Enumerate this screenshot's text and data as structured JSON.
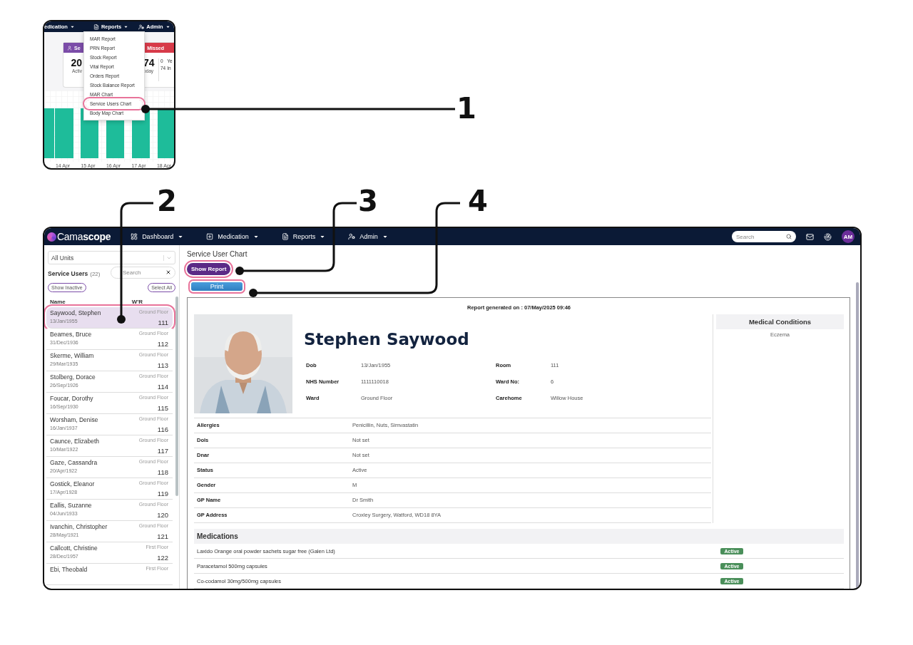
{
  "inset": {
    "nav": [
      {
        "label": "edication"
      },
      {
        "label": "Reports"
      },
      {
        "label": "Admin"
      }
    ],
    "cards": {
      "tabs": [
        {
          "label": "Se"
        },
        {
          "label": "Missed"
        }
      ],
      "stats": [
        {
          "value": "20",
          "caption": "Activ"
        },
        {
          "value": "74",
          "caption": "oday"
        }
      ],
      "extra": [
        "0",
        "Ye",
        "74",
        "In"
      ]
    },
    "chart_x_labels": [
      "14 Apr",
      "15 Apr",
      "16 Apr",
      "17 Apr",
      "18 Apr"
    ],
    "menu": [
      {
        "label": "MAR Report",
        "highlighted": false
      },
      {
        "label": "PRN Report",
        "highlighted": false
      },
      {
        "label": "Stock Report",
        "highlighted": false
      },
      {
        "label": "Vital Report",
        "highlighted": false
      },
      {
        "label": "Orders Report",
        "highlighted": false
      },
      {
        "label": "Stock Balance Report",
        "highlighted": false
      },
      {
        "label": "MAR Chart",
        "highlighted": false
      },
      {
        "label": "Service Users Chart",
        "highlighted": true
      },
      {
        "label": "Body Map Chart",
        "highlighted": false
      }
    ]
  },
  "app": {
    "logo": "Cama**scope**",
    "nav": [
      {
        "label": "Dashboard"
      },
      {
        "label": "Medication"
      },
      {
        "label": "Reports"
      },
      {
        "label": "Admin"
      }
    ],
    "search": {
      "placeholder": "Search"
    },
    "avatar": "AM"
  },
  "sidebar": {
    "unit_select": "All Units",
    "title": "Service Users",
    "count": "(22)",
    "search": {
      "placeholder": "Search"
    },
    "show_inactive": "Show Inactive",
    "select_all": "Select All",
    "columns": [
      "Name",
      "W'R"
    ],
    "rows": [
      {
        "name": "Saywood, Stephen",
        "dob": "13/Jan/1955",
        "ward": "Ground Floor",
        "room": "111",
        "selected": true,
        "highlighted": true
      },
      {
        "name": "Beames, Bruce",
        "dob": "31/Dec/1936",
        "ward": "Ground Floor",
        "room": "112",
        "selected": false,
        "highlighted": false
      },
      {
        "name": "Skerme, William",
        "dob": "29/Mar/1935",
        "ward": "Ground Floor",
        "room": "113",
        "selected": false,
        "highlighted": false
      },
      {
        "name": "Stolberg, Dorace",
        "dob": "26/Sep/1926",
        "ward": "Ground Floor",
        "room": "114",
        "selected": false,
        "highlighted": false
      },
      {
        "name": "Foucar, Dorothy",
        "dob": "16/Sep/1930",
        "ward": "Ground Floor",
        "room": "115",
        "selected": false,
        "highlighted": false
      },
      {
        "name": "Worsham, Denise",
        "dob": "16/Jan/1937",
        "ward": "Ground Floor",
        "room": "116",
        "selected": false,
        "highlighted": false
      },
      {
        "name": "Caunce, Elizabeth",
        "dob": "10/Mar/1922",
        "ward": "Ground Floor",
        "room": "117",
        "selected": false,
        "highlighted": false
      },
      {
        "name": "Gaze, Cassandra",
        "dob": "20/Apr/1922",
        "ward": "Ground Floor",
        "room": "118",
        "selected": false,
        "highlighted": false
      },
      {
        "name": "Gostick, Eleanor",
        "dob": "17/Apr/1928",
        "ward": "Ground Floor",
        "room": "119",
        "selected": false,
        "highlighted": false
      },
      {
        "name": "Eallis, Suzanne",
        "dob": "04/Jun/1933",
        "ward": "Ground Floor",
        "room": "120",
        "selected": false,
        "highlighted": false
      },
      {
        "name": "Ivanchin, Christopher",
        "dob": "28/May/1921",
        "ward": "Ground Floor",
        "room": "121",
        "selected": false,
        "highlighted": false
      },
      {
        "name": "Callcott, Christine",
        "dob": "28/Dec/1957",
        "ward": "First Floor",
        "room": "122",
        "selected": false,
        "highlighted": false
      },
      {
        "name": "Ebi, Theobald",
        "ward": "First Floor",
        "selected": false,
        "highlighted": false
      }
    ]
  },
  "content": {
    "title": "Service User Chart",
    "show_report": {
      "label": "Show Report",
      "highlighted": true
    },
    "print": {
      "label": "Print",
      "highlighted": true
    },
    "report": {
      "generated": "Report generated on : 07/May/2025 09:46",
      "name": "Stephen Saywood",
      "details": [
        {
          "label": "Dob",
          "value": "13/Jan/1955"
        },
        {
          "label": "Room",
          "value": "111"
        },
        {
          "label": "NHS Number",
          "value": "1111110018"
        },
        {
          "label": "Ward No:",
          "value": "6"
        },
        {
          "label": "Ward",
          "value": "Ground Floor"
        },
        {
          "label": "Carehome",
          "value": "Willow House"
        }
      ],
      "info": [
        {
          "label": "Allergies",
          "value": "Penicillin, Nuts, Simvastatin"
        },
        {
          "label": "Dols",
          "value": "Not set"
        },
        {
          "label": "Dnar",
          "value": "Not set"
        },
        {
          "label": "Status",
          "value": "Active"
        },
        {
          "label": "Gender",
          "value": "M"
        },
        {
          "label": "GP Name",
          "value": "Dr Smith"
        },
        {
          "label": "GP Address",
          "value": "Croxley Surgery, Watford, WD18 8YA"
        }
      ],
      "conditions_title": "Medical Conditions",
      "conditions": [
        "Eczema"
      ],
      "medications_title": "Medications",
      "medications": [
        {
          "name": "Laxido Orange oral powder sachets sugar free (Galen Ltd)",
          "status": "Active",
          "kind": "active"
        },
        {
          "name": "Paracetamol 500mg capsules",
          "status": "Active",
          "kind": "active"
        },
        {
          "name": "Co-codamol 30mg/500mg capsules",
          "status": "Active",
          "kind": "active"
        }
      ]
    }
  },
  "callouts": [
    {
      "number": "1"
    },
    {
      "number": "2"
    },
    {
      "number": "3"
    },
    {
      "number": "4"
    }
  ]
}
